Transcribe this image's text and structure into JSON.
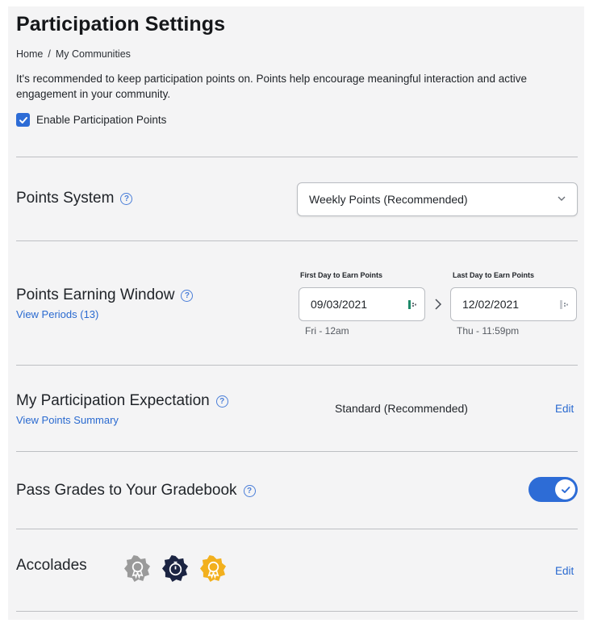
{
  "page": {
    "title": "Participation Settings",
    "breadcrumb": {
      "home": "Home",
      "separator": "/",
      "current": "My Communities"
    },
    "intro": "It's recommended to keep participation points on. Points help encourage meaningful interaction and active engagement in your community.",
    "enable_label": "Enable Participation Points",
    "enable_checked": true
  },
  "points_system": {
    "label": "Points System",
    "selected": "Weekly Points (Recommended)",
    "icons": {
      "help": "help-icon",
      "dropdown": "chevron-down-icon"
    }
  },
  "earning_window": {
    "label": "Points Earning Window",
    "link": "View Periods (13)",
    "first": {
      "caption": "First Day to Earn Points",
      "value": "09/03/2021",
      "sub": "Fri - 12am"
    },
    "last": {
      "caption": "Last Day to Earn Points",
      "value": "12/02/2021",
      "sub": "Thu - 11:59pm"
    },
    "icons": {
      "calendar": "calendar-icon",
      "separator": "chevron-right-icon"
    }
  },
  "expectation": {
    "label": "My Participation Expectation",
    "link": "View Points Summary",
    "value": "Standard (Recommended)",
    "edit": "Edit"
  },
  "gradebook": {
    "label": "Pass Grades to Your Gradebook",
    "enabled": true
  },
  "accolades": {
    "label": "Accolades",
    "edit": "Edit",
    "badges": [
      {
        "icon": "gray-medal-badge-icon",
        "color": "#9a9a9a"
      },
      {
        "icon": "navy-timer-badge-icon",
        "color": "#1b2442"
      },
      {
        "icon": "gold-medal-badge-icon",
        "color": "#f2b01e"
      }
    ]
  },
  "colors": {
    "accent": "#2d6cd6",
    "link": "#2a6ad0"
  }
}
